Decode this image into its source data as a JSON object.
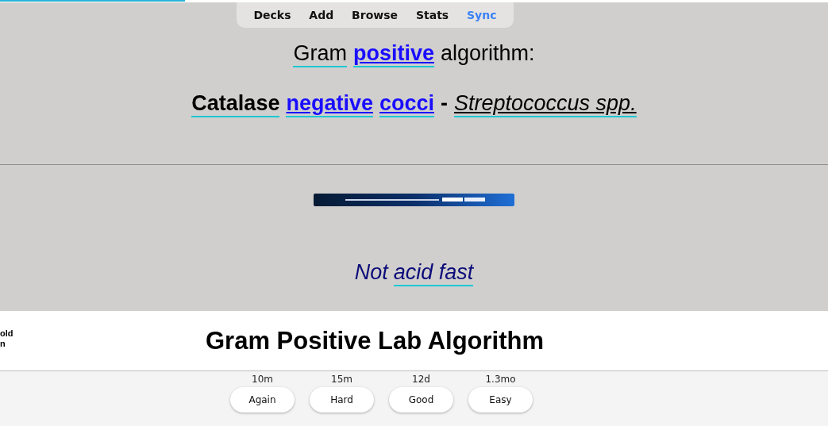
{
  "progress": {
    "level": 0.223
  },
  "nav": [
    {
      "label": "Decks",
      "highlighted": false
    },
    {
      "label": "Add",
      "highlighted": false
    },
    {
      "label": "Browse",
      "highlighted": false
    },
    {
      "label": "Stats",
      "highlighted": false
    },
    {
      "label": "Sync",
      "highlighted": true
    }
  ],
  "front": {
    "lines": [
      {
        "segments": [
          {
            "text": "Gram",
            "bold": false,
            "italic": false,
            "link": false,
            "tagged": true
          },
          {
            "text": "positive",
            "bold": true,
            "italic": false,
            "link": true,
            "tagged": true
          },
          {
            "text": "algorithm:",
            "bold": false,
            "italic": false,
            "link": false,
            "tagged": false
          }
        ]
      },
      {
        "segments": [
          {
            "text": "Catalase",
            "bold": true,
            "italic": false,
            "link": false,
            "tagged": true
          },
          {
            "text": "negative",
            "bold": true,
            "italic": false,
            "link": true,
            "tagged": true
          },
          {
            "text": "cocci",
            "bold": true,
            "italic": false,
            "link": true,
            "tagged": true
          },
          {
            "text": "-",
            "bold": true,
            "italic": false,
            "link": false,
            "tagged": false
          },
          {
            "text": "Streptococcus spp.",
            "bold": false,
            "italic": true,
            "link": false,
            "tagged": true
          }
        ]
      }
    ]
  },
  "back": {
    "answer": {
      "segments": [
        {
          "text": "Not",
          "tagged": false
        },
        {
          "text": "acid fast",
          "tagged": true
        }
      ]
    }
  },
  "footer": {
    "side": [
      "old",
      "n"
    ],
    "title": "Gram Positive Lab Algorithm"
  },
  "answers": [
    {
      "label": "Again",
      "interval": "10m"
    },
    {
      "label": "Hard",
      "interval": "15m"
    },
    {
      "label": "Good",
      "interval": "12d"
    },
    {
      "label": "Easy",
      "interval": "1.3mo"
    }
  ]
}
